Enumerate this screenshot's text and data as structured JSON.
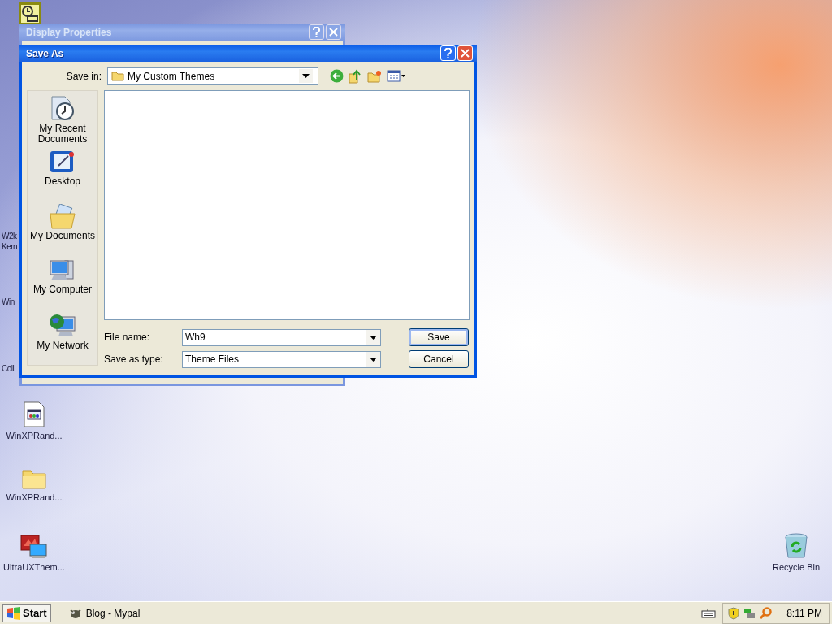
{
  "desktop": {
    "partial_labels": [
      "W2k",
      "Kern",
      "Win",
      "Coll"
    ],
    "icons": [
      {
        "kind": "scheduler"
      },
      {
        "kind": "file",
        "label": "WinXPRand..."
      },
      {
        "kind": "folder",
        "label": "WinXPRand..."
      },
      {
        "kind": "theme",
        "label": "UltraUXThem..."
      },
      {
        "kind": "recycle",
        "label": "Recycle Bin"
      }
    ]
  },
  "windows": [
    {
      "title": "Display Properties",
      "active": false
    },
    {
      "title": "Save As",
      "active": true
    }
  ],
  "save_as": {
    "save_in_label": "Save in:",
    "location": "My Custom Themes",
    "places": [
      {
        "kind": "recent",
        "label": "My Recent Documents"
      },
      {
        "kind": "desktop",
        "label": "Desktop"
      },
      {
        "kind": "documents",
        "label": "My Documents"
      },
      {
        "kind": "computer",
        "label": "My Computer"
      },
      {
        "kind": "network",
        "label": "My Network"
      }
    ],
    "file_name_label": "File name:",
    "file_name": "Wh9",
    "type_label": "Save as type:",
    "type": "Theme Files",
    "buttons": [
      {
        "label": "Save",
        "default": true
      },
      {
        "label": "Cancel",
        "default": false
      }
    ]
  },
  "taskbar": {
    "start": "Start",
    "tasks": [
      {
        "label": "Blog - Mypal"
      }
    ],
    "clock": "8:11 PM"
  }
}
